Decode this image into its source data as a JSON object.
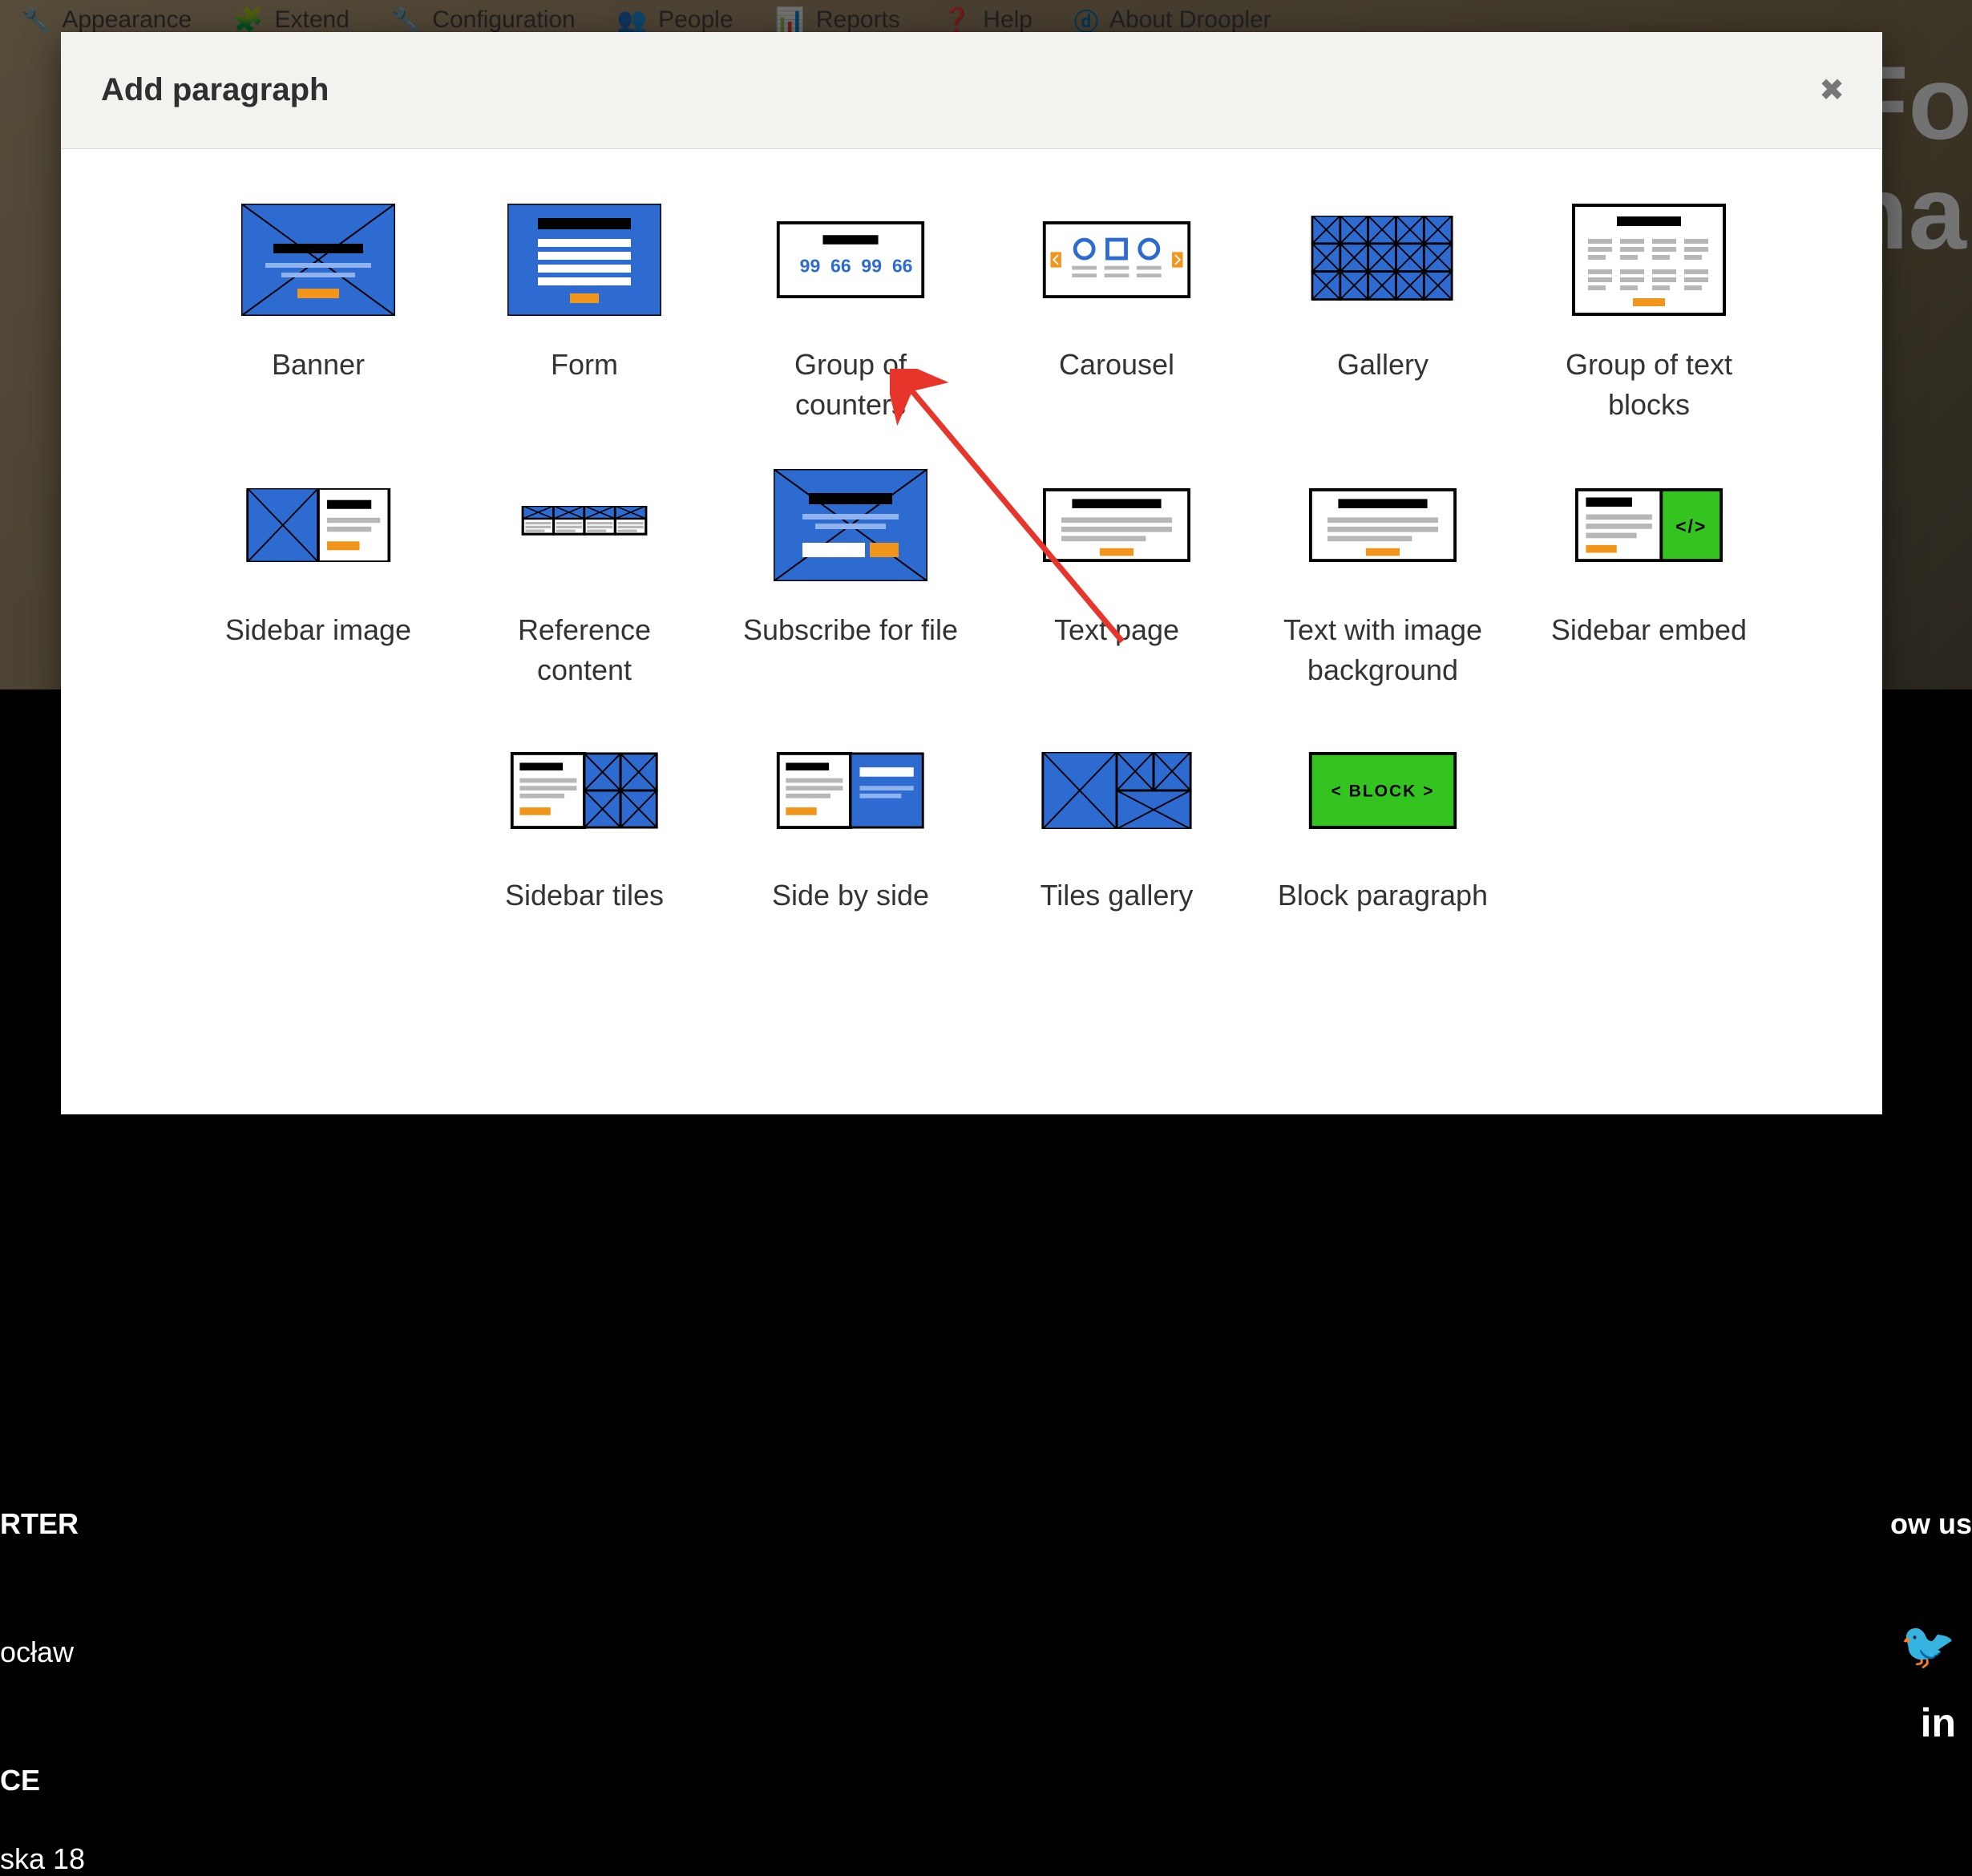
{
  "admin_menu": {
    "appearance": "Appearance",
    "extend": "Extend",
    "configuration": "Configuration",
    "people": "People",
    "reports": "Reports",
    "help": "Help",
    "about": "About Droopler"
  },
  "modal": {
    "title": "Add paragraph",
    "paragraphs": {
      "banner": "Banner",
      "form": "Form",
      "group_of_counters": "Group of counters",
      "carousel": "Carousel",
      "gallery": "Gallery",
      "group_of_text_blocks": "Group of text blocks",
      "sidebar_image": "Sidebar image",
      "reference_content": "Reference content",
      "subscribe_for_file": "Subscribe for file",
      "text_page": "Text page",
      "text_with_image_background": "Text with image background",
      "sidebar_embed": "Sidebar embed",
      "sidebar_tiles": "Sidebar tiles",
      "side_by_side": "Side by side",
      "tiles_gallery": "Tiles gallery",
      "block_paragraph": "Block paragraph"
    }
  },
  "background": {
    "big_text_line1": "Fo",
    "big_text_line2": "ha",
    "hq_label": "RTER",
    "city": "ocław",
    "ce_label": "CE",
    "street": "ska 18",
    "follow": "ow us"
  }
}
